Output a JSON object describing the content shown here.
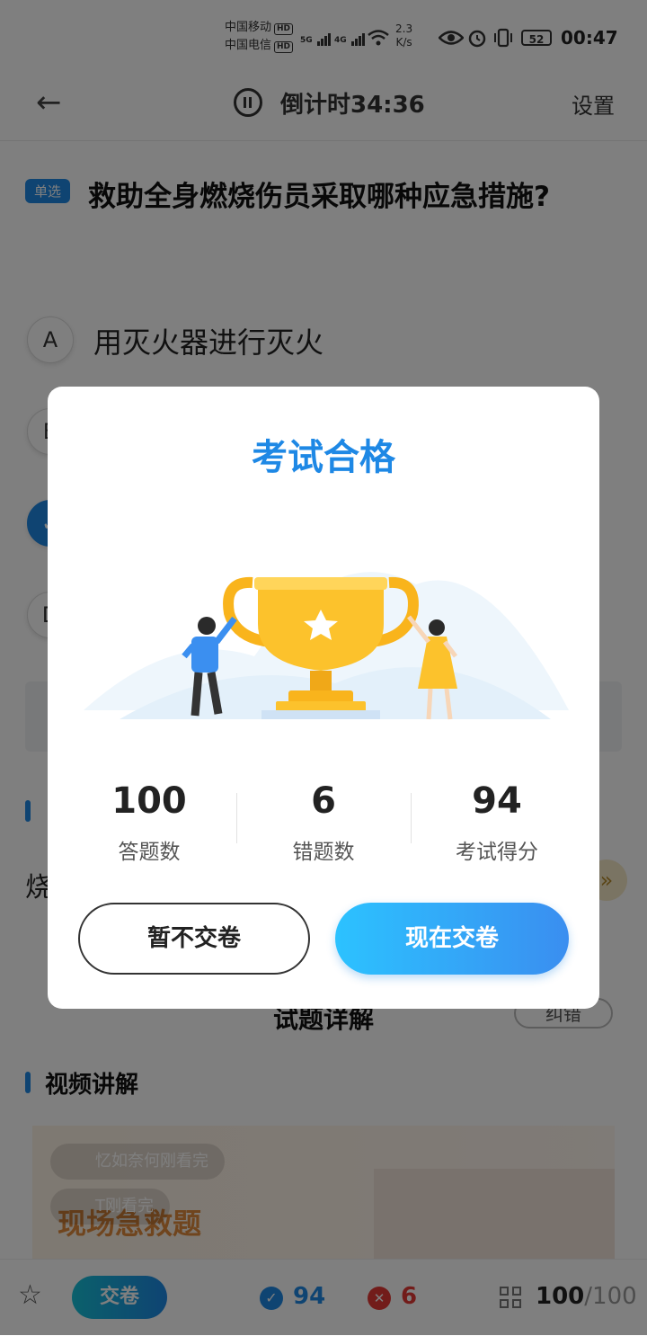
{
  "status_bar": {
    "carrier1": "中国移动",
    "carrier2": "中国电信",
    "hd": "HD",
    "net1": "5G",
    "net2": "4G",
    "speed_value": "2.3",
    "speed_unit": "K/s",
    "battery": "52",
    "time": "00:47"
  },
  "header": {
    "countdown": "倒计时34:36",
    "settings": "设置"
  },
  "question": {
    "type": "单选",
    "text": "救助全身燃烧伤员采取哪种应急措施?"
  },
  "options": [
    {
      "letter": "A",
      "text": "用灭火器进行灭火"
    },
    {
      "letter": "B",
      "text": ""
    },
    {
      "letter": "C",
      "text": ""
    },
    {
      "letter": "D",
      "text": ""
    }
  ],
  "background_text": {
    "analysis_fragment": "烧",
    "detail_title": "试题详解",
    "correct_button": "纠错",
    "video_section": "视频讲解",
    "danmu1": "忆如奈何刚看完",
    "danmu2": "T刚看完",
    "video_title": "现场急救题"
  },
  "modal": {
    "title": "考试合格",
    "stats": [
      {
        "value": "100",
        "label": "答题数"
      },
      {
        "value": "6",
        "label": "错题数"
      },
      {
        "value": "94",
        "label": "考试得分"
      }
    ],
    "later_button": "暂不交卷",
    "now_button": "现在交卷"
  },
  "bottom_bar": {
    "submit": "交卷",
    "correct": "94",
    "wrong": "6",
    "progress_current": "100",
    "progress_total": "/100"
  },
  "colors": {
    "accent": "#1e88e5",
    "error": "#e53935",
    "trophy": "#f9b41c"
  }
}
